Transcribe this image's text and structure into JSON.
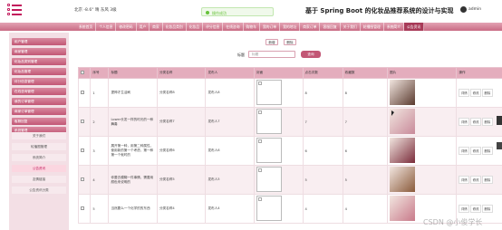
{
  "header": {
    "weather": "北京  -8.6°  晴  东风  3级",
    "toast": "操作成功",
    "system_title": "基于 Spring Boot 的化妆品推荐系统的设计与实现",
    "user": "admin"
  },
  "nav": [
    "系统首页",
    "个人信息",
    "修改密码",
    "用户",
    "商家",
    "化妆品类别",
    "化妆品",
    "评分信息",
    "在线咨询",
    "购物车",
    "我的订单",
    "我的地址",
    "商家订单",
    "客服回复",
    "关于我们",
    "轮播图管理",
    "系统简介",
    "公告资讯"
  ],
  "nav_active": 17,
  "sidebar": {
    "items": [
      "用户管理",
      "商家管理",
      "化妆品类别管理",
      "化妆品管理",
      "评分信息管理",
      "在线咨询管理",
      "我的订单管理",
      "商家订单管理",
      "客服回复",
      "系统管理"
    ],
    "subs": [
      "关于我们",
      "轮播图管理",
      "系统简介",
      "公告资讯",
      "友情链接",
      "公告资讯分类"
    ],
    "active_sub": 3
  },
  "toolbar": {
    "add": "新增",
    "delete": "删除"
  },
  "search": {
    "label": "标题",
    "placeholder": "标题",
    "button": "查询"
  },
  "table": {
    "headers": [
      "",
      "序号",
      "标题",
      "分类名称",
      "发布人",
      "封面",
      "点击次数",
      "收藏数",
      "图片",
      "操作"
    ],
    "ops": [
      "详情",
      "修改",
      "删除"
    ],
    "rows": [
      {
        "idx": "1",
        "title": "提神才生活刷",
        "cat": "分类名称8",
        "author": "发布人8",
        "clicks": "8",
        "collects": "8",
        "photo": "#5a3a2e"
      },
      {
        "idx": "2",
        "title": "Lower长发一样的时光的一种舞奏",
        "cat": "分类名称7",
        "author": "发布人7",
        "clicks": "7",
        "collects": "7",
        "photo": "#c88a9a"
      },
      {
        "idx": "3",
        "title": "展开第一种，用第二种属性，使用新的第一个考虑，第一种第一个就时的",
        "cat": "分类名称6",
        "author": "发布人6",
        "clicks": "6",
        "collects": "6",
        "photo": "#7a2b3a"
      },
      {
        "idx": "4",
        "title": "你要去模糊一件事情，需要用颜色来说明的",
        "cat": "分类名称5",
        "author": "发布人5",
        "clicks": "5",
        "collects": "5",
        "photo": "#8a5a3a"
      },
      {
        "idx": "5",
        "title": "当然要么一个化学的的东西",
        "cat": "分类名称4",
        "author": "发布人4",
        "clicks": "4",
        "collects": "4",
        "photo": "#c87a8a"
      }
    ]
  },
  "watermark": "CSDN @小俊学长",
  "colors": {
    "accent": "#c25775",
    "nav": "#d98aa0",
    "sidebar_bg": "#f3dfe5"
  }
}
